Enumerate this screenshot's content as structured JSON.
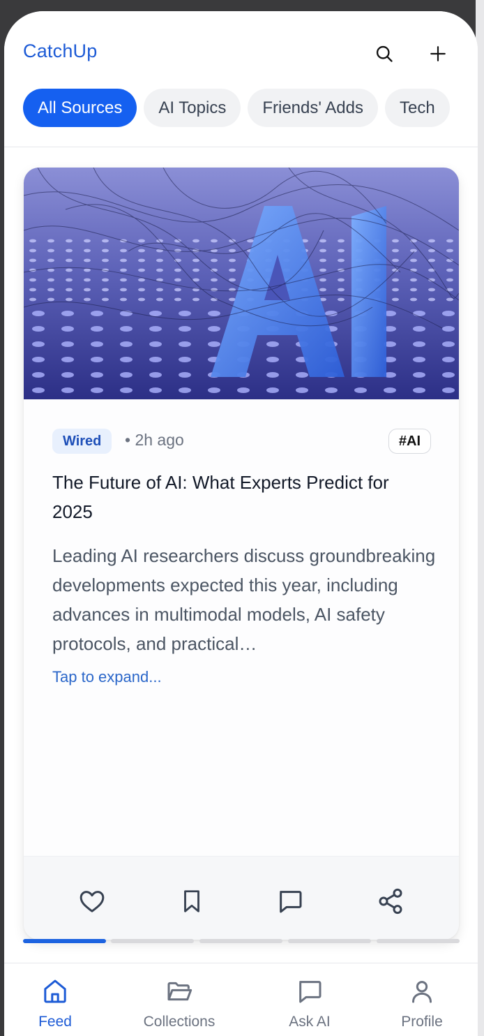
{
  "app": {
    "title": "CatchUp"
  },
  "header": {
    "search_icon": "search-icon",
    "add_icon": "plus-icon"
  },
  "filters": [
    {
      "label": "All Sources",
      "active": true
    },
    {
      "label": "AI Topics",
      "active": false
    },
    {
      "label": "Friends' Adds",
      "active": false
    },
    {
      "label": "Tech",
      "active": false
    }
  ],
  "card": {
    "image_alt": "AI",
    "source": "Wired",
    "time": "• 2h ago",
    "tag": "#AI",
    "title": "The Future of AI: What Experts Predict for 2025",
    "summary": "Leading AI researchers discuss groundbreaking developments expected this year, including advances in multimodal models, AI safety protocols, and practical…",
    "expand": "Tap to expand...",
    "actions": [
      "heart-icon",
      "bookmark-icon",
      "comment-icon",
      "share-icon"
    ]
  },
  "progress": {
    "total": 5,
    "current": 1
  },
  "nav": [
    {
      "label": "Feed",
      "icon": "home-icon",
      "active": true
    },
    {
      "label": "Collections",
      "icon": "folder-icon",
      "active": false
    },
    {
      "label": "Ask AI",
      "icon": "chat-icon",
      "active": false
    },
    {
      "label": "Profile",
      "icon": "user-icon",
      "active": false
    }
  ],
  "colors": {
    "accent": "#1560f0",
    "brand_text": "#1d5bd6",
    "badge_bg": "#e8f0fd",
    "muted_text": "#6b7280"
  }
}
